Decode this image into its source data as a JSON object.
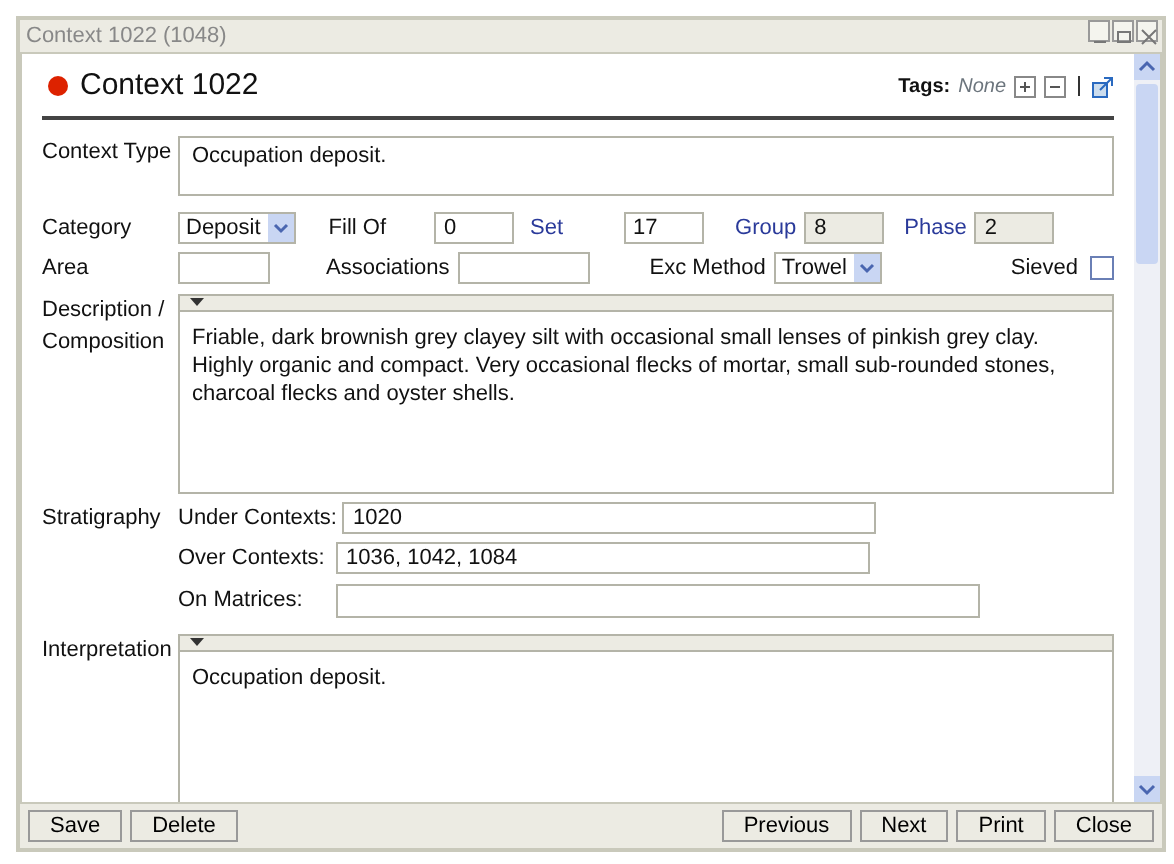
{
  "window": {
    "title": "Context 1022 (1048)"
  },
  "header": {
    "title": "Context 1022",
    "tags_label": "Tags:",
    "tags_value": "None"
  },
  "context_type": {
    "label": "Context Type",
    "value": "Occupation deposit."
  },
  "row1": [
    {
      "kind": "select",
      "label": "Category",
      "value": "Deposit"
    },
    {
      "kind": "input",
      "label": "Fill Of",
      "value": "0"
    },
    {
      "kind": "link-input",
      "label": "Set",
      "value": "17"
    },
    {
      "kind": "link-readonly",
      "label": "Group",
      "value": "8"
    },
    {
      "kind": "link-readonly",
      "label": "Phase",
      "value": "2"
    }
  ],
  "row2": [
    {
      "kind": "input",
      "label": "Area"
    },
    {
      "kind": "input",
      "label": "Associations"
    },
    {
      "kind": "select",
      "label": "Exc Method",
      "value": "Trowel"
    },
    {
      "kind": "checkbox",
      "label": "Sieved",
      "checked": false
    }
  ],
  "description": {
    "label": "Description / Composition",
    "value": "Friable, dark brownish grey clayey silt with occasional small lenses of pinkish grey clay. Highly organic and compact. Very occasional flecks of mortar, small sub-rounded stones, charcoal flecks and oyster shells."
  },
  "stratigraphy": {
    "label": "Stratigraphy",
    "rows": [
      {
        "label": "Under Contexts:",
        "value": "1020"
      },
      {
        "label": "Over Contexts:",
        "value": "1036, 1042, 1084"
      },
      {
        "label": "On Matrices:"
      }
    ]
  },
  "interpretation": {
    "label": "Interpretation",
    "value": "Occupation deposit."
  },
  "buttons_left": [
    "Save",
    "Delete"
  ],
  "buttons_right": [
    "Previous",
    "Next",
    "Print",
    "Close"
  ]
}
